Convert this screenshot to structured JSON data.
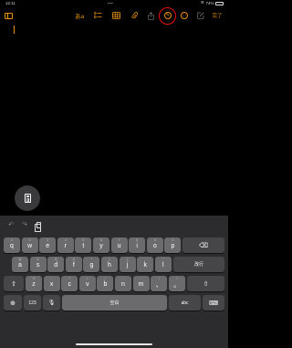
{
  "status_bar": {
    "time": "12:11",
    "dots": "•••",
    "battery": "74%"
  },
  "toolbar": {
    "text_format_label": "あa",
    "done_label": "完了",
    "icons": [
      "sidebar-icon",
      "checklist-icon",
      "table-icon",
      "paperclip-icon",
      "share-icon",
      "markup-icon",
      "more-icon",
      "compose-icon"
    ]
  },
  "keyboard": {
    "row1": [
      {
        "main": "q",
        "hint": "1"
      },
      {
        "main": "w",
        "hint": "2"
      },
      {
        "main": "e",
        "hint": "3"
      },
      {
        "main": "r",
        "hint": "4"
      },
      {
        "main": "t",
        "hint": "5"
      },
      {
        "main": "y",
        "hint": "6"
      },
      {
        "main": "u",
        "hint": "7"
      },
      {
        "main": "i",
        "hint": "8"
      },
      {
        "main": "o",
        "hint": "9"
      },
      {
        "main": "p",
        "hint": "0"
      }
    ],
    "row2": [
      {
        "main": "a",
        "hint": "@"
      },
      {
        "main": "s",
        "hint": "#"
      },
      {
        "main": "d",
        "hint": "$"
      },
      {
        "main": "f",
        "hint": "&"
      },
      {
        "main": "g",
        "hint": "*"
      },
      {
        "main": "h",
        "hint": "("
      },
      {
        "main": "j",
        "hint": ")"
      },
      {
        "main": "k",
        "hint": "'"
      },
      {
        "main": "l",
        "hint": "\""
      }
    ],
    "row3": [
      {
        "main": "z",
        "hint": "%"
      },
      {
        "main": "x",
        "hint": "-"
      },
      {
        "main": "c",
        "hint": "+"
      },
      {
        "main": "v",
        "hint": "="
      },
      {
        "main": "b",
        "hint": "/"
      },
      {
        "main": "n",
        "hint": ";"
      },
      {
        "main": "m",
        "hint": ":"
      },
      {
        "main": "、",
        "hint": "!"
      },
      {
        "main": "。",
        "hint": "?"
      }
    ],
    "enter_label": "改行",
    "shift_symbol": "⇧",
    "backspace_symbol": "⌫",
    "globe_symbol": "⊕",
    "numbers_label": "123",
    "mic_symbol": "🎙",
    "space_label": "空白",
    "abc_label": "abc",
    "dismiss_symbol": "⌨"
  }
}
